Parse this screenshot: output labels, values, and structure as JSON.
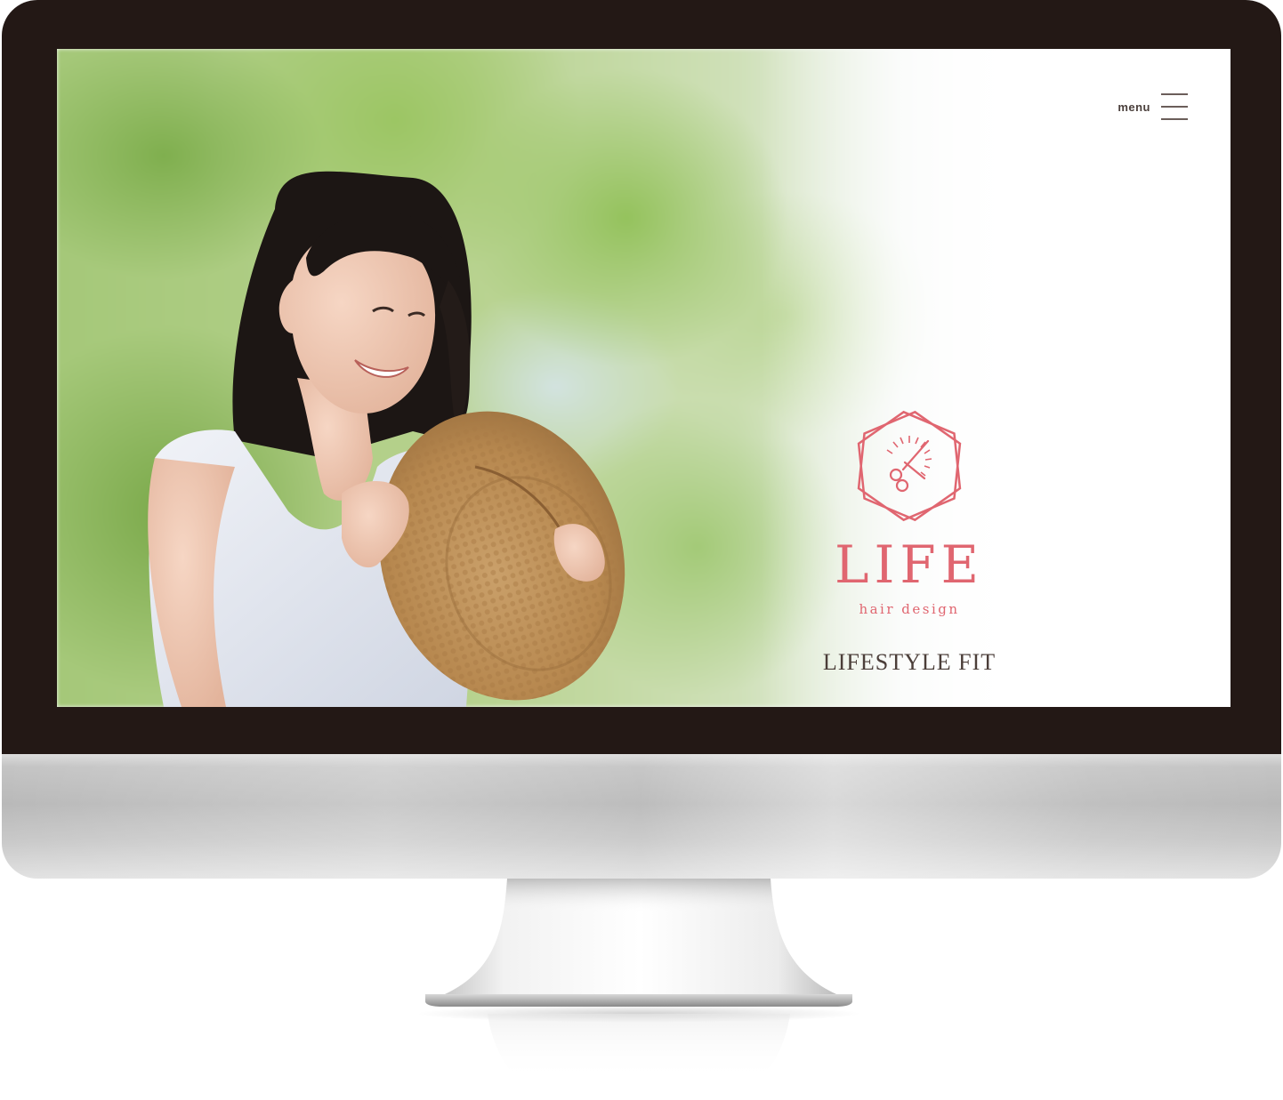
{
  "header": {
    "menu_label": "menu"
  },
  "logo": {
    "wordmark": "LIFE",
    "subtitle": "hair design",
    "icon": "scissors-hexagon-icon",
    "color": "#e06670"
  },
  "hero": {
    "tagline": "LIFESTYLE FIT",
    "image": "woman-with-straw-hat-photo"
  },
  "colors": {
    "bezel": "#231815",
    "text_dark": "#4b3e39",
    "accent": "#e06670"
  }
}
